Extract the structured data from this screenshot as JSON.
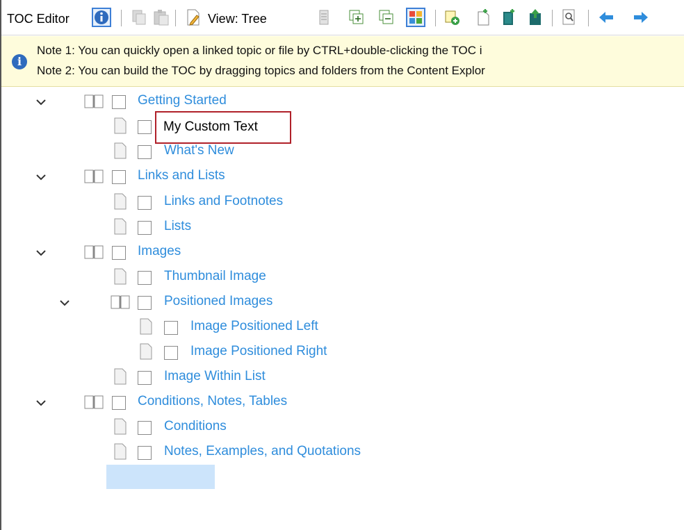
{
  "toolbar": {
    "title": "TOC Editor",
    "view_label": "View: Tree",
    "icons": [
      "info-icon",
      "copy-icon",
      "paste-icon",
      "edit-document-icon",
      "view-tree-icon",
      "list-icon",
      "expand-all-icon",
      "collapse-all-icon",
      "grid-view-icon",
      "add-link-icon",
      "new-topic-icon",
      "new-book-icon",
      "insert-above-icon",
      "find-icon",
      "back-arrow-icon",
      "forward-arrow-icon"
    ],
    "accent": "#3d7fd6"
  },
  "note": {
    "line1": "Note 1: You can quickly open a linked topic or file by CTRL+double-clicking the TOC i",
    "line2": "Note 2: You can build the TOC by dragging topics and folders from the Content Explor"
  },
  "tree": {
    "link_color": "#2f8ddc",
    "items": [
      {
        "label": "Getting Started"
      },
      {
        "label": "My Custom Text"
      },
      {
        "label": "What's New"
      },
      {
        "label": "Links and Lists"
      },
      {
        "label": "Links and Footnotes"
      },
      {
        "label": "Lists"
      },
      {
        "label": "Images"
      },
      {
        "label": "Thumbnail Image"
      },
      {
        "label": "Positioned Images"
      },
      {
        "label": "Image Positioned Left"
      },
      {
        "label": "Image Positioned Right"
      },
      {
        "label": "Image Within List"
      },
      {
        "label": "Conditions, Notes, Tables"
      },
      {
        "label": "Conditions"
      },
      {
        "label": "Notes, Examples, and Quotations"
      }
    ]
  }
}
